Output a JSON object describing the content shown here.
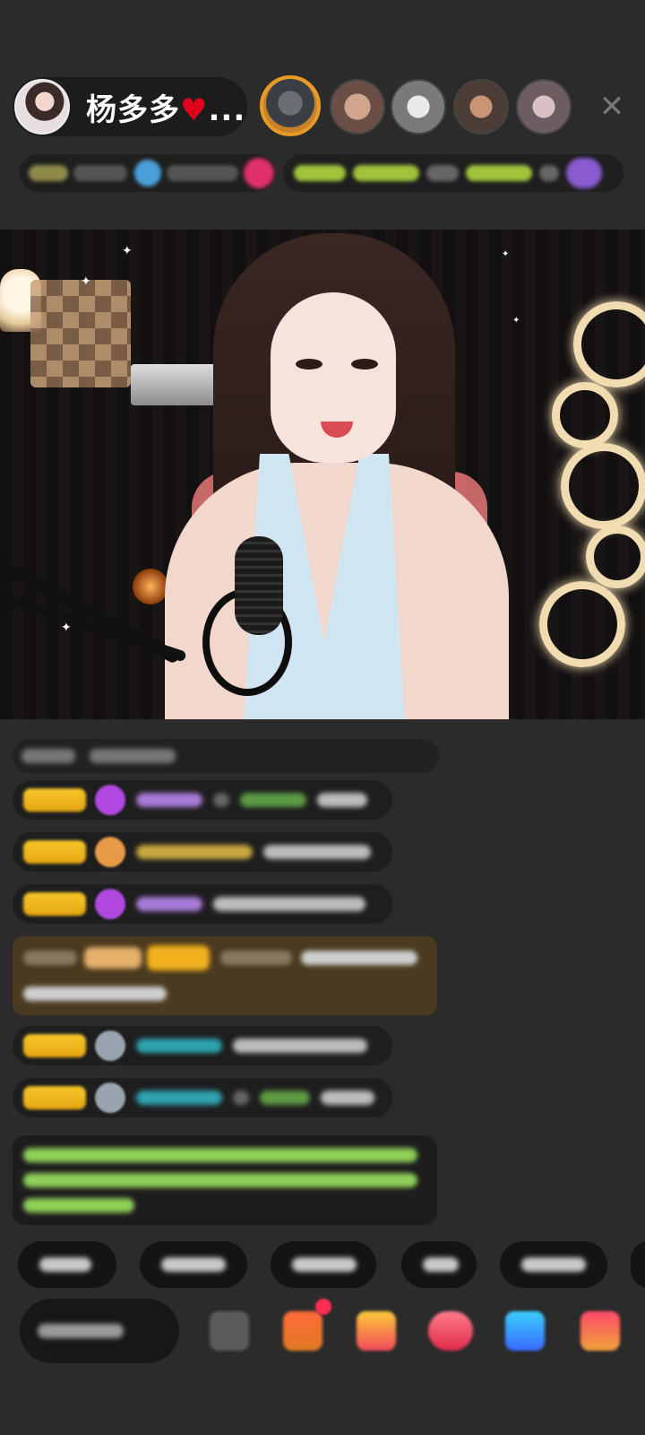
{
  "header": {
    "host_name": "杨多多",
    "host_heart": "♥",
    "host_ellipsis": "...",
    "close_label": "✕"
  },
  "colors": {
    "background": "#2b2b2b",
    "badge_gold": "#f6c72a",
    "highlight_message_bg": "#4b3a1f",
    "notice_text": "#8fcf59",
    "heart_red": "#e0001c"
  },
  "icons": {
    "close": "close-icon",
    "heart": "heart-icon"
  }
}
